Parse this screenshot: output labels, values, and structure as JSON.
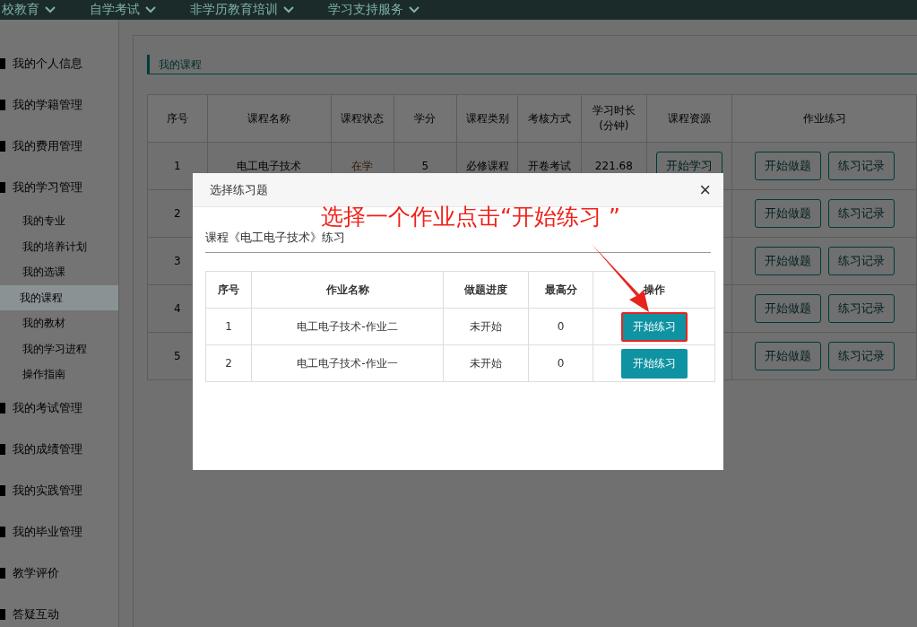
{
  "nav": [
    {
      "label": "校教育"
    },
    {
      "label": "自学考试"
    },
    {
      "label": "非学历教育培训"
    },
    {
      "label": "学习支持服务"
    }
  ],
  "sidebar": [
    {
      "label": "我的个人信息"
    },
    {
      "label": "我的学籍管理"
    },
    {
      "label": "我的费用管理"
    },
    {
      "label": "我的学习管理",
      "children": [
        {
          "label": "我的专业",
          "selected": false
        },
        {
          "label": "我的培养计划",
          "selected": false
        },
        {
          "label": "我的选课",
          "selected": false
        },
        {
          "label": "我的课程",
          "selected": true
        },
        {
          "label": "我的教材",
          "selected": false
        },
        {
          "label": "我的学习进程",
          "selected": false
        },
        {
          "label": "操作指南",
          "selected": false
        }
      ]
    },
    {
      "label": "我的考试管理"
    },
    {
      "label": "我的成绩管理"
    },
    {
      "label": "我的实践管理"
    },
    {
      "label": "我的毕业管理"
    },
    {
      "label": "教学评价"
    },
    {
      "label": "答疑互动"
    }
  ],
  "section_title": "我的课程",
  "courses": {
    "columns": [
      "序号",
      "课程名称",
      "课程状态",
      "学分",
      "课程类别",
      "考核方式",
      "学习时长\n(分钟)",
      "课程资源",
      "作业练习"
    ],
    "rows": [
      {
        "index": "1",
        "name": "电工电子技术",
        "status": "在学",
        "credits": "5",
        "category": "必修课程",
        "assessment": "开卷考试",
        "duration": "221.68",
        "resource_button": "开始学习",
        "buttons": [
          "开始做题",
          "练习记录"
        ]
      },
      {
        "index": "2",
        "buttons": [
          "开始做题",
          "练习记录"
        ]
      },
      {
        "index": "3",
        "buttons": [
          "开始做题",
          "练习记录"
        ]
      },
      {
        "index": "4",
        "buttons": [
          "开始做题",
          "练习记录"
        ]
      },
      {
        "index": "5",
        "buttons": [
          "开始做题",
          "练习记录"
        ]
      }
    ]
  },
  "dialog": {
    "title": "选择练习题",
    "close": "×",
    "subtitle": "课程《电工电子技术》练习",
    "columns": [
      "序号",
      "作业名称",
      "做题进度",
      "最高分",
      "操作"
    ],
    "rows": [
      {
        "index": "1",
        "name": "电工电子技术-作业二",
        "progress": "未开始",
        "score": "0",
        "button": "开始练习",
        "highlighted": true
      },
      {
        "index": "2",
        "name": "电工电子技术-作业一",
        "progress": "未开始",
        "score": "0",
        "button": "开始练习",
        "highlighted": false
      }
    ]
  },
  "annotation": {
    "text": "选择一个作业点击“开始练习 ”"
  }
}
